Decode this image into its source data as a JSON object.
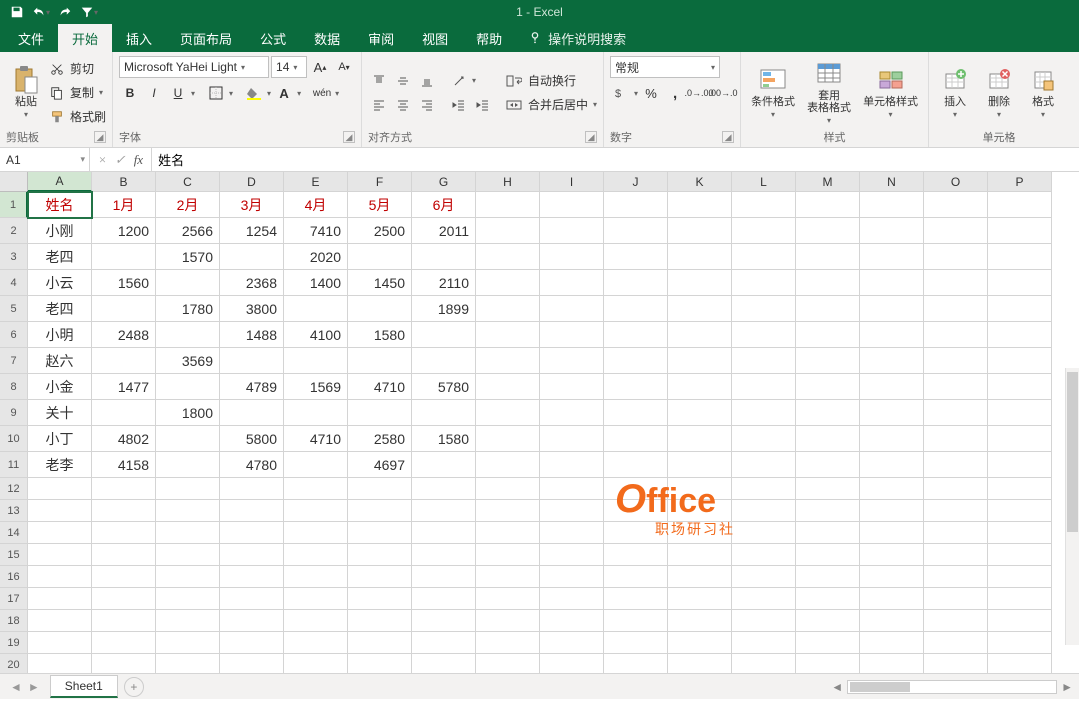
{
  "app": {
    "title": "1 - Excel"
  },
  "tabs": {
    "file": "文件",
    "home": "开始",
    "insert": "插入",
    "layout": "页面布局",
    "formulas": "公式",
    "data": "数据",
    "review": "审阅",
    "view": "视图",
    "help": "帮助",
    "tell": "操作说明搜索"
  },
  "ribbon": {
    "clipboard": {
      "paste": "粘贴",
      "cut": "剪切",
      "copy": "复制",
      "painter": "格式刷",
      "label": "剪贴板"
    },
    "font": {
      "name": "Microsoft YaHei Light",
      "size": "14",
      "bold": "B",
      "italic": "I",
      "underline": "U",
      "label": "字体",
      "wen": "wén"
    },
    "align": {
      "wrap": "自动换行",
      "merge": "合并后居中",
      "label": "对齐方式"
    },
    "number": {
      "format": "常规",
      "label": "数字"
    },
    "styles": {
      "cond": "条件格式",
      "table": "套用\n表格格式",
      "cell": "单元格样式",
      "label": "样式"
    },
    "cells": {
      "insert": "插入",
      "delete": "删除",
      "format": "格式",
      "label": "单元格"
    }
  },
  "formula": {
    "cellref": "A1",
    "value": "姓名"
  },
  "sheet": {
    "columns": [
      "A",
      "B",
      "C",
      "D",
      "E",
      "F",
      "G",
      "H",
      "I",
      "J",
      "K",
      "L",
      "M",
      "N",
      "O",
      "P"
    ],
    "headers": [
      "姓名",
      "1月",
      "2月",
      "3月",
      "4月",
      "5月",
      "6月"
    ],
    "rows": [
      [
        "小刚",
        "1200",
        "2566",
        "1254",
        "7410",
        "2500",
        "2011"
      ],
      [
        "老四",
        "",
        "1570",
        "",
        "2020",
        "",
        ""
      ],
      [
        "小云",
        "1560",
        "",
        "2368",
        "1400",
        "1450",
        "2110"
      ],
      [
        "老四",
        "",
        "1780",
        "3800",
        "",
        "",
        "1899"
      ],
      [
        "小明",
        "2488",
        "",
        "1488",
        "4100",
        "1580",
        ""
      ],
      [
        "赵六",
        "",
        "3569",
        "",
        "",
        "",
        ""
      ],
      [
        "小金",
        "1477",
        "",
        "4789",
        "1569",
        "4710",
        "5780"
      ],
      [
        "关十",
        "",
        "1800",
        "",
        "",
        "",
        ""
      ],
      [
        "小丁",
        "4802",
        "",
        "5800",
        "4710",
        "2580",
        "1580"
      ],
      [
        "老李",
        "4158",
        "",
        "4780",
        "",
        "4697",
        ""
      ]
    ]
  },
  "tabbar": {
    "sheet1": "Sheet1"
  },
  "watermark": {
    "brand1": "O",
    "brand2": "ffice",
    "sub": "职场研习社"
  }
}
